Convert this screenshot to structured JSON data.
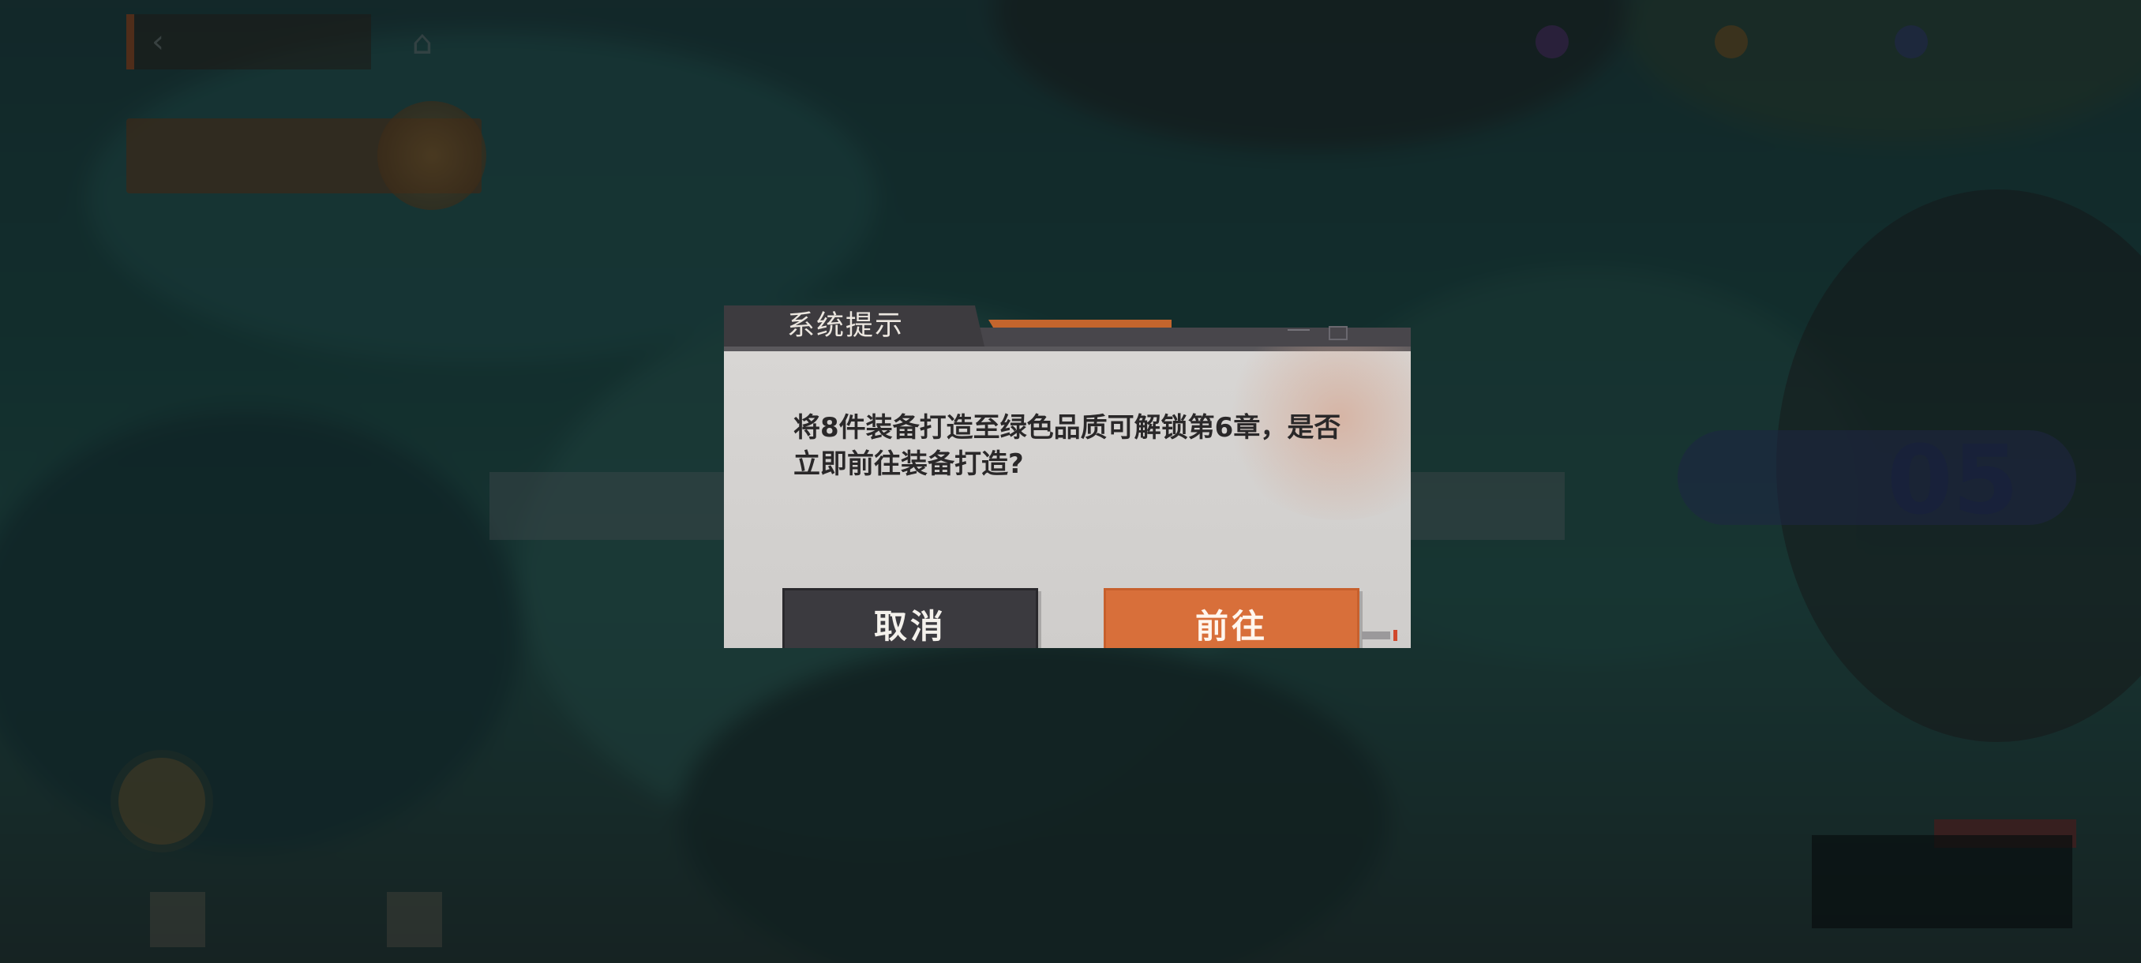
{
  "dialog": {
    "title": "系统提示",
    "message": "将8件装备打造至绿色品质可解锁第6章，是否立即前往装备打造?",
    "cancel_label": "取消",
    "confirm_label": "前往"
  },
  "colors": {
    "confirm_button": "#d86f3a",
    "cancel_button": "#3b3a3f",
    "dialog_body": "#d6d4d2",
    "accent_orange": "#c4652d"
  },
  "background": {
    "top_nav": {
      "icons": [
        "back-arrow-icon",
        "home-icon"
      ]
    },
    "currencies": {
      "icons": [
        "gem-icon",
        "gold-coin-icon",
        "energy-icon"
      ]
    },
    "stage_number": "05"
  }
}
